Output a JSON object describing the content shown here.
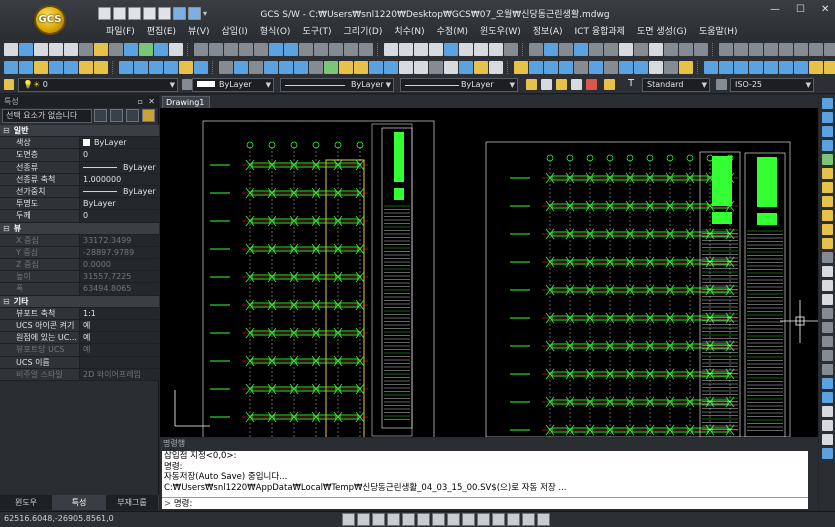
{
  "window": {
    "title": "GCS S/W - C:₩Users₩snl1220₩Desktop₩GCS₩07_오월₩신당동근린생활.mdwg",
    "logo_text": "GCS",
    "controls": [
      "—",
      "☐",
      "✕"
    ]
  },
  "menu": [
    "파일(F)",
    "편집(E)",
    "뷰(V)",
    "삽입(I)",
    "형식(O)",
    "도구(T)",
    "그리기(D)",
    "치수(N)",
    "수정(M)",
    "윈도우(W)",
    "정보(A)",
    "ICT 융합과제",
    "도면 생성(G)",
    "도움말(H)"
  ],
  "propbar": {
    "layer": "0",
    "color": "ByLayer",
    "linetype": "ByLayer",
    "lineweight": "ByLayer",
    "textstyle": "Standard",
    "dimstyle": "ISO-25"
  },
  "left_panel": {
    "title": "특성",
    "selection": "선택 요소가 없습니다",
    "close_glyph": "✕",
    "rows": [
      {
        "type": "cat",
        "key": "일반"
      },
      {
        "key": "색상",
        "value": "ByLayer",
        "swatch": true
      },
      {
        "key": "도면층",
        "value": "0"
      },
      {
        "key": "선종류",
        "value": "ByLayer",
        "line": true
      },
      {
        "key": "선종류 축척",
        "value": "1.000000"
      },
      {
        "key": "선가중치",
        "value": "ByLayer",
        "line": true
      },
      {
        "key": "투명도",
        "value": "ByLayer"
      },
      {
        "key": "두께",
        "value": "0"
      },
      {
        "type": "cat",
        "key": "뷰"
      },
      {
        "key": "X 중심",
        "value": "33172.3499",
        "dis": true
      },
      {
        "key": "Y 중심",
        "value": "-28897.9789",
        "dis": true
      },
      {
        "key": "Z 중심",
        "value": "0.0000",
        "dis": true
      },
      {
        "key": "높이",
        "value": "31557.7225",
        "dis": true
      },
      {
        "key": "폭",
        "value": "63494.8065",
        "dis": true
      },
      {
        "type": "cat",
        "key": "기타"
      },
      {
        "key": "뷰포트 축척",
        "value": "1:1"
      },
      {
        "key": "UCS 아이콘 켜기",
        "value": "예"
      },
      {
        "key": "원점에 있는 UC...",
        "value": "예"
      },
      {
        "key": "뷰포트당 UCS",
        "value": "예",
        "dis": true
      },
      {
        "key": "UCS 이름",
        "value": ""
      },
      {
        "key": "비주얼 스타일",
        "value": "2D 와이어프레임",
        "dis": true
      }
    ],
    "tabs": [
      "윈도우",
      "특성",
      "부재그룹"
    ]
  },
  "document": {
    "tab": "Drawing1"
  },
  "command": {
    "title": "명령행",
    "log": [
      "삽입점 지정<0,0>:",
      "명령:",
      "자동저장(Auto Save) 중입니다...",
      "C:₩Users₩snl1220₩AppData₩Local₩Temp₩신당동근린생활_04_03_15_00.SV$(으)로 자동 저장 ..."
    ],
    "prompt": "명령:"
  },
  "status": {
    "coords": "62516.6048,-26905.8561,0"
  },
  "colors": {
    "accent_green": "#33ff33",
    "grid_white": "#ffffff",
    "beam_yellow": "#e8c64a",
    "dim_red": "#ff3030"
  }
}
